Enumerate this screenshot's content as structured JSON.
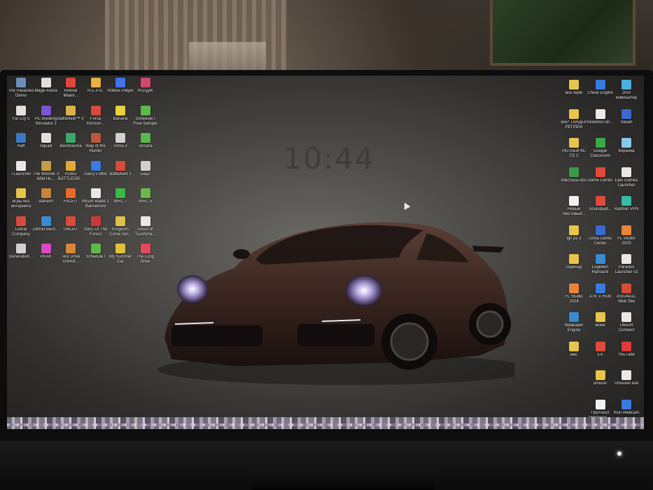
{
  "clock": {
    "time": "10:44"
  },
  "left_icons": [
    {
      "label": "The Parasites Demo",
      "color": "#6b8fb8",
      "icon": "game-icon"
    },
    {
      "label": "Mage Arena",
      "color": "#e0e0e0",
      "icon": "game-icon"
    },
    {
      "label": "Hotline Miami...",
      "color": "#e0463a",
      "icon": "game-icon"
    },
    {
      "label": "R.E.P.O.",
      "color": "#e8b040",
      "icon": "game-icon"
    },
    {
      "label": "Roblox Player",
      "color": "#3f74e8",
      "icon": "roblox-icon"
    },
    {
      "label": "РОЛДЖ",
      "color": "#d0486a",
      "icon": "game-icon"
    },
    {
      "label": "Far Cry 5",
      "color": "#e0e0e0",
      "icon": "game-icon"
    },
    {
      "label": "PC Building Simulator 2",
      "color": "#7b53d6",
      "icon": "game-icon"
    },
    {
      "label": "Battlefield™ V",
      "color": "#d8b24a",
      "icon": "game-icon"
    },
    {
      "label": "Forza Horizon...",
      "color": "#d84a3a",
      "icon": "game-icon"
    },
    {
      "label": "Banana",
      "color": "#e6d23a",
      "icon": "game-icon"
    },
    {
      "label": "Schedule I Free Sample",
      "color": "#5fb84a",
      "icon": "game-icon"
    },
    {
      "label": "Raft",
      "color": "#3a78c0",
      "icon": "game-icon"
    },
    {
      "label": "Squad",
      "color": "#e0e0e0",
      "icon": "game-icon"
    },
    {
      "label": "Barotrauma",
      "color": "#3aa86a",
      "icon": "game-icon"
    },
    {
      "label": "Way of the Hunter",
      "color": "#b85a3a",
      "icon": "game-icon"
    },
    {
      "label": "Arma 3",
      "color": "#d0d0d0",
      "icon": "game-icon"
    },
    {
      "label": "Terraria",
      "color": "#58b84a",
      "icon": "game-icon"
    },
    {
      "label": "TLauncher",
      "color": "#e8e8e8",
      "icon": "launcher-icon"
    },
    {
      "label": "The Witcher 3 Wild Hu...",
      "color": "#c89a4a",
      "icon": "game-icon"
    },
    {
      "label": "PUBG BATTLEGR...",
      "color": "#e0a83a",
      "icon": "game-icon"
    },
    {
      "label": "Garry's Mod",
      "color": "#3a7ae0",
      "icon": "game-icon"
    },
    {
      "label": "Battlefield 1",
      "color": "#d84a3a",
      "icon": "game-icon"
    },
    {
      "label": "DayZ",
      "color": "#d0d0d0",
      "icon": "game-icon"
    },
    {
      "label": "игры без интернета",
      "color": "#e8c44a",
      "icon": "folder-icon"
    },
    {
      "label": "Valheim",
      "color": "#c8843a",
      "icon": "game-icon"
    },
    {
      "label": "FACEIT",
      "color": "#e86a2a",
      "icon": "game-icon"
    },
    {
      "label": "Mount Blade 2 Bannerlord",
      "color": "#e8e8e8",
      "icon": "game-icon"
    },
    {
      "label": "WRC 7",
      "color": "#3ab84a",
      "icon": "game-icon"
    },
    {
      "label": "WRC 5",
      "color": "#6ab84a",
      "icon": "game-icon"
    },
    {
      "label": "Lethal Company",
      "color": "#d84a3a",
      "icon": "game-icon"
    },
    {
      "label": "Detroit Beco...",
      "color": "#3a8ad0",
      "icon": "game-icon"
    },
    {
      "label": "UBOAT",
      "color": "#d84a3a",
      "icon": "game-icon"
    },
    {
      "label": "Sons Of The Forest",
      "color": "#c83a3a",
      "icon": "game-icon"
    },
    {
      "label": "Kingdom Come Del...",
      "color": "#e0c04a",
      "icon": "game-icon"
    },
    {
      "label": "Ghost of Tsushima...",
      "color": "#e8e8e8",
      "icon": "game-icon"
    },
    {
      "label": "Generation...",
      "color": "#d0d0d0",
      "icon": "game-icon"
    },
    {
      "label": "PEAK",
      "color": "#d84ac0",
      "icon": "game-icon"
    },
    {
      "label": "Test Drive Unlimit...",
      "color": "#d8843a",
      "icon": "game-icon"
    },
    {
      "label": "Schedule I",
      "color": "#5fb84a",
      "icon": "game-icon"
    },
    {
      "label": "My Summer Car",
      "color": "#e0c03a",
      "icon": "game-icon"
    },
    {
      "label": "The Long Drive",
      "color": "#e04a5a",
      "icon": "game-icon"
    }
  ],
  "right_icons": [
    {
      "label": "все reple",
      "color": "#e8c44a",
      "icon": "folder-icon"
    },
    {
      "label": "Cheat Engine",
      "color": "#3a7ae0",
      "icon": "app-icon"
    },
    {
      "label": "Этот компьютер",
      "color": "#4ab0e0",
      "icon": "computer-icon"
    },
    {
      "label": "ВАР ТАНДЕР РЕПЛЕИ",
      "color": "#e8c44a",
      "icon": "folder-icon"
    },
    {
      "label": "Skeleton-Sh...",
      "color": "#e8e8e8",
      "icon": "app-icon"
    },
    {
      "label": "Steam",
      "color": "#3a6ad0",
      "icon": "steam-icon"
    },
    {
      "label": "РЕПЛЕИ КС ГО 2",
      "color": "#e8c44a",
      "icon": "folder-icon"
    },
    {
      "label": "Google Classroom",
      "color": "#3aa84a",
      "icon": "app-icon"
    },
    {
      "label": "Корзина",
      "color": "#8ac8e8",
      "icon": "trash-icon"
    },
    {
      "label": "Мастера.xlsx",
      "color": "#3a9a4a",
      "icon": "file-icon"
    },
    {
      "label": "Game Center",
      "color": "#e04a3a",
      "icon": "app-icon"
    },
    {
      "label": "Epic Games Launcher",
      "color": "#e8e8e8",
      "icon": "app-icon"
    },
    {
      "label": "Новый текстовый...",
      "color": "#f0f0f0",
      "icon": "file-icon"
    },
    {
      "label": "Soundpad...",
      "color": "#e04a3a",
      "icon": "app-icon"
    },
    {
      "label": "Radmin VPN",
      "color": "#3ab8a8",
      "icon": "app-icon"
    },
    {
      "label": "igri ps 3",
      "color": "#e8c44a",
      "icon": "folder-icon"
    },
    {
      "label": "Lesta Game Center",
      "color": "#3a6ad0",
      "icon": "app-icon"
    },
    {
      "label": "FL Studio 2025",
      "color": "#e8843a",
      "icon": "app-icon"
    },
    {
      "label": "соунпад",
      "color": "#e8c44a",
      "icon": "folder-icon"
    },
    {
      "label": "LogMeIn Hamachi",
      "color": "#3a8ad0",
      "icon": "app-icon"
    },
    {
      "label": "Paradox Launcher v2",
      "color": "#e8e8e8",
      "icon": "app-icon"
    },
    {
      "label": "FL Studio 2024",
      "color": "#e8843a",
      "icon": "app-icon"
    },
    {
      "label": "ATK V HUB",
      "color": "#3a7ae0",
      "icon": "app-icon"
    },
    {
      "label": "ASIO4ALL Web Site",
      "color": "#d84a3a",
      "icon": "app-icon"
    },
    {
      "label": "Wallpaper Engine",
      "color": "#3a8ad0",
      "icon": "app-icon"
    },
    {
      "label": "моей",
      "color": "#e8c44a",
      "icon": "folder-icon"
    },
    {
      "label": "Ubisoft Connect",
      "color": "#e8e8e8",
      "icon": "app-icon"
    },
    {
      "label": "мас",
      "color": "#e8c44a",
      "icon": "folder-icon"
    },
    {
      "label": "EA",
      "color": "#e04a3a",
      "icon": "app-icon"
    },
    {
      "label": "YouTube",
      "color": "#e03a3a",
      "icon": "app-icon"
    },
    {
      "label": "",
      "color": "",
      "icon": ""
    },
    {
      "label": "unlocer",
      "color": "#e8c44a",
      "icon": "folder-icon"
    },
    {
      "label": "Unlocker.exe",
      "color": "#e8e8e8",
      "icon": "app-icon"
    },
    {
      "label": "",
      "color": "",
      "icon": ""
    },
    {
      "label": "Протокол приёмаль...",
      "color": "#f0f0f0",
      "icon": "file-icon"
    },
    {
      "label": "Iriun Webcam",
      "color": "#3a7ae0",
      "icon": "app-icon"
    }
  ]
}
